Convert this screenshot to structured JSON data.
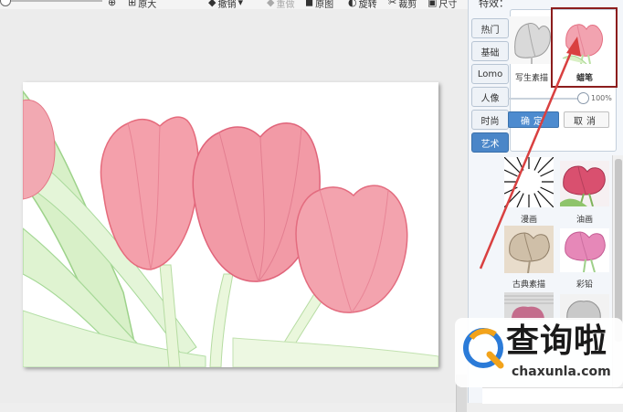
{
  "toolbar": {
    "items": [
      {
        "name": "zoom-in",
        "icon": "zoom-in-icon",
        "glyph": "⊕",
        "label": ""
      },
      {
        "name": "original-size",
        "icon": "original-size-icon",
        "glyph": "⊞",
        "label": "原大"
      },
      {
        "name": "undo",
        "icon": "undo-icon",
        "glyph": "◆",
        "label": "撤销"
      },
      {
        "name": "redo",
        "icon": "redo-icon",
        "glyph": "◆",
        "label": "重做"
      },
      {
        "name": "restore",
        "icon": "restore-icon",
        "glyph": "◼",
        "label": "原图"
      },
      {
        "name": "rotate",
        "icon": "rotate-icon",
        "glyph": "◐",
        "label": "旋转"
      },
      {
        "name": "crop",
        "icon": "crop-icon",
        "glyph": "✂",
        "label": "裁剪"
      },
      {
        "name": "resize",
        "icon": "resize-icon",
        "glyph": "▣",
        "label": "尺寸"
      }
    ]
  },
  "panel": {
    "title": "特效：",
    "tabs": [
      {
        "label": "热门",
        "active": false
      },
      {
        "label": "基础",
        "active": false
      },
      {
        "label": "Lomo",
        "active": false
      },
      {
        "label": "人像",
        "active": false
      },
      {
        "label": "时尚",
        "active": false
      },
      {
        "label": "艺术",
        "active": true
      }
    ],
    "selected_effects": [
      {
        "label": "写生素描"
      },
      {
        "label": "蜡笔"
      }
    ],
    "slider": {
      "value_percent": 100,
      "label": "100%"
    },
    "ok_label": "确定",
    "cancel_label": "取消",
    "effects": [
      {
        "label": "漫画"
      },
      {
        "label": "油画"
      },
      {
        "label": "古典素描"
      },
      {
        "label": "彩铅"
      }
    ]
  },
  "watermark": {
    "main": "查询啦",
    "sub": "chaxunla.com"
  },
  "colors": {
    "accent": "#4a86c8",
    "highlight": "#8c1d1d",
    "arrow": "#d94040"
  }
}
